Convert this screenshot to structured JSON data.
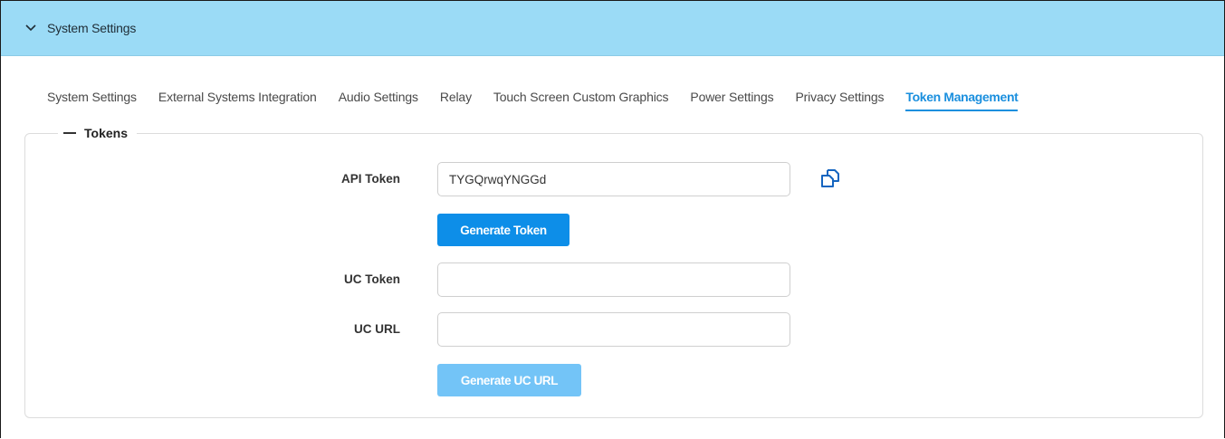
{
  "header": {
    "title": "System Settings",
    "chevron_icon": "chevron-down-icon",
    "background_color": "#9bdbf6"
  },
  "tabs": [
    {
      "label": "System Settings",
      "active": false
    },
    {
      "label": "External Systems Integration",
      "active": false
    },
    {
      "label": "Audio Settings",
      "active": false
    },
    {
      "label": "Relay",
      "active": false
    },
    {
      "label": "Touch Screen Custom Graphics",
      "active": false
    },
    {
      "label": "Power Settings",
      "active": false
    },
    {
      "label": "Privacy Settings",
      "active": false
    },
    {
      "label": "Token Management",
      "active": true
    }
  ],
  "tokens_section": {
    "legend": "Tokens",
    "api_token": {
      "label": "API Token",
      "value": "TYGQrwqYNGGd",
      "copy_icon": "copy-icon"
    },
    "generate_token_button": "Generate Token",
    "uc_token": {
      "label": "UC Token",
      "value": ""
    },
    "uc_url": {
      "label": "UC URL",
      "value": ""
    },
    "generate_uc_url_button": "Generate UC URL"
  },
  "colors": {
    "accent": "#0d8ee8",
    "accent_disabled": "#73c4f7",
    "active_tab": "#1a8fde"
  }
}
